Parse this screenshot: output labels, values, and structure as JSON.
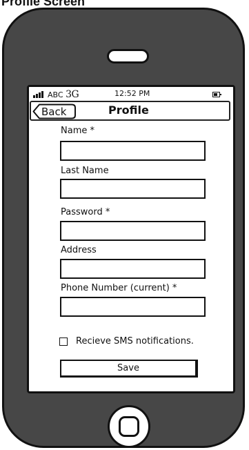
{
  "page": {
    "heading": "Profile Screen"
  },
  "status_bar": {
    "signal_icon": "signal-bars-icon",
    "carrier": "ABC",
    "network": "3G",
    "time": "12:52 PM",
    "battery_icon": "battery-icon"
  },
  "nav": {
    "back_label": "Back",
    "title": "Profile"
  },
  "form": {
    "fields": [
      {
        "label": "Name *",
        "value": "",
        "placeholder": ""
      },
      {
        "label": "Last Name",
        "value": "",
        "placeholder": ""
      },
      {
        "label": "Password *",
        "value": "",
        "placeholder": ""
      },
      {
        "label": "Address",
        "value": "",
        "placeholder": ""
      },
      {
        "label": "Phone Number (current) *",
        "value": "",
        "placeholder": ""
      }
    ],
    "sms_checkbox": {
      "label": "Recieve SMS notifications.",
      "checked": false
    },
    "save_label": "Save"
  },
  "colors": {
    "phone_body": "#474747",
    "outline": "#111111",
    "screen": "#ffffff"
  }
}
